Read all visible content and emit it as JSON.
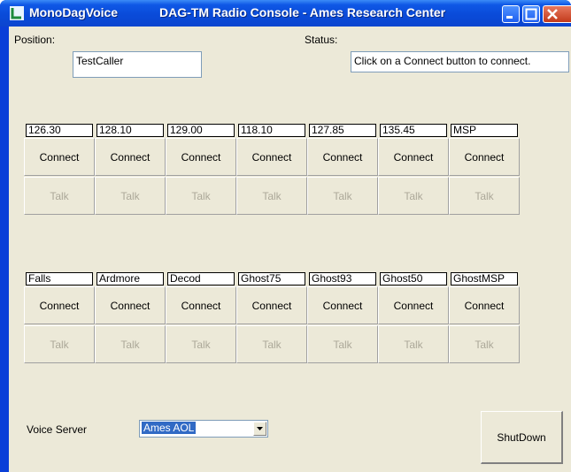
{
  "window": {
    "app_name": "MonoDagVoice",
    "title": "DAG-TM Radio Console - Ames Research Center"
  },
  "position": {
    "label": "Position:",
    "value": "TestCaller"
  },
  "status": {
    "label": "Status:",
    "value": "Click on a Connect button to connect."
  },
  "channels_row1": [
    {
      "freq": "126.30",
      "connect": "Connect",
      "talk": "Talk"
    },
    {
      "freq": "128.10",
      "connect": "Connect",
      "talk": "Talk"
    },
    {
      "freq": "129.00",
      "connect": "Connect",
      "talk": "Talk"
    },
    {
      "freq": "118.10",
      "connect": "Connect",
      "talk": "Talk"
    },
    {
      "freq": "127.85",
      "connect": "Connect",
      "talk": "Talk"
    },
    {
      "freq": "135.45",
      "connect": "Connect",
      "talk": "Talk"
    },
    {
      "freq": "MSP",
      "connect": "Connect",
      "talk": "Talk"
    }
  ],
  "channels_row2": [
    {
      "freq": "Falls",
      "connect": "Connect",
      "talk": "Talk"
    },
    {
      "freq": "Ardmore",
      "connect": "Connect",
      "talk": "Talk"
    },
    {
      "freq": "Decod",
      "connect": "Connect",
      "talk": "Talk"
    },
    {
      "freq": "Ghost75",
      "connect": "Connect",
      "talk": "Talk"
    },
    {
      "freq": "Ghost93",
      "connect": "Connect",
      "talk": "Talk"
    },
    {
      "freq": "Ghost50",
      "connect": "Connect",
      "talk": "Talk"
    },
    {
      "freq": "GhostMSP",
      "connect": "Connect",
      "talk": "Talk"
    }
  ],
  "voice_server": {
    "label": "Voice Server",
    "selected": "Ames AOL"
  },
  "shutdown_label": "ShutDown"
}
